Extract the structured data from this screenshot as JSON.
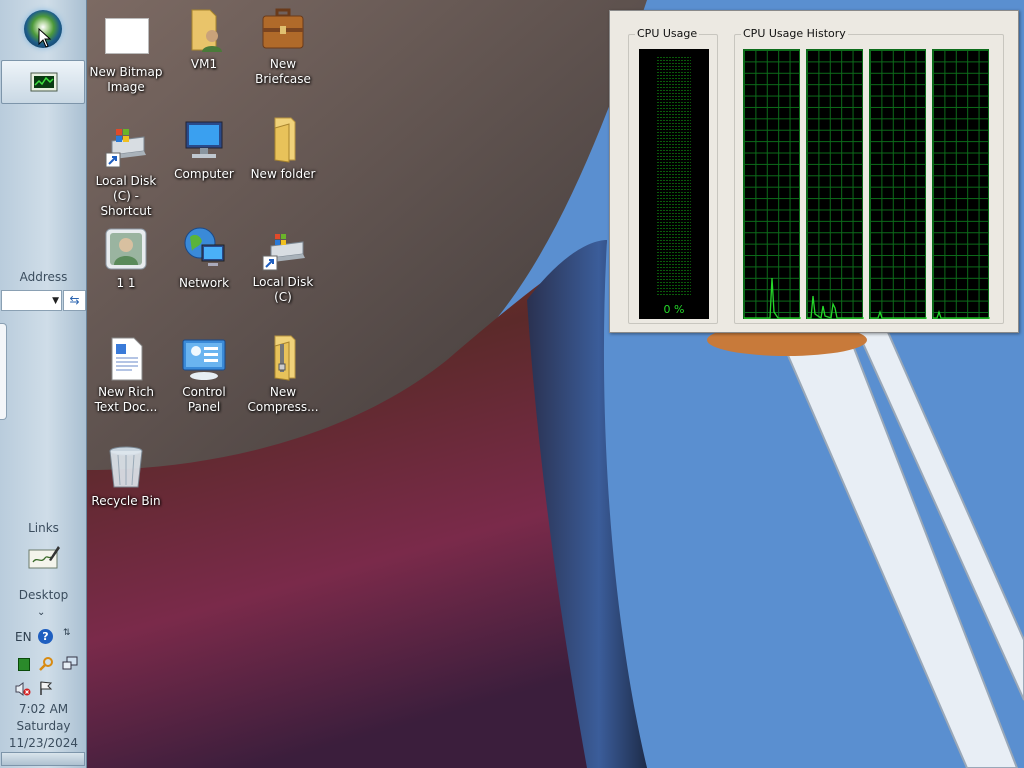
{
  "taskbar": {
    "address_label": "Address",
    "links_label": "Links",
    "desktop_label": "Desktop",
    "language": "EN",
    "help_glyph": "?",
    "clock": {
      "time": "7:02 AM",
      "day": "Saturday",
      "date": "11/23/2024"
    }
  },
  "desktop_icons": [
    {
      "label": "New Bitmap Image",
      "icon": "bitmap-image-icon"
    },
    {
      "label": "VM1",
      "icon": "user-folder-icon"
    },
    {
      "label": "New Briefcase",
      "icon": "briefcase-icon"
    },
    {
      "label": "Local Disk (C) - Shortcut",
      "icon": "drive-shortcut-icon"
    },
    {
      "label": "Computer",
      "icon": "computer-icon"
    },
    {
      "label": "New folder",
      "icon": "folder-icon"
    },
    {
      "label": "1 1",
      "icon": "user-account-icon"
    },
    {
      "label": "Network",
      "icon": "network-icon"
    },
    {
      "label": "Local Disk (C)",
      "icon": "drive-shortcut-icon"
    },
    {
      "label": "New Rich Text Doc...",
      "icon": "rich-text-doc-icon"
    },
    {
      "label": "Control Panel",
      "icon": "control-panel-icon"
    },
    {
      "label": "New Compress...",
      "icon": "zip-folder-icon"
    },
    {
      "label": "Recycle Bin",
      "icon": "recycle-bin-icon"
    }
  ],
  "cpu_window": {
    "usage_title": "CPU Usage",
    "history_title": "CPU Usage History",
    "usage_value": "0 %",
    "history_cores": 4
  },
  "colors": {
    "graph_green": "#25d82a",
    "grid_green": "#0c6b1a",
    "taskbar": "#c4d4e1",
    "sky": "#3f86d6"
  }
}
